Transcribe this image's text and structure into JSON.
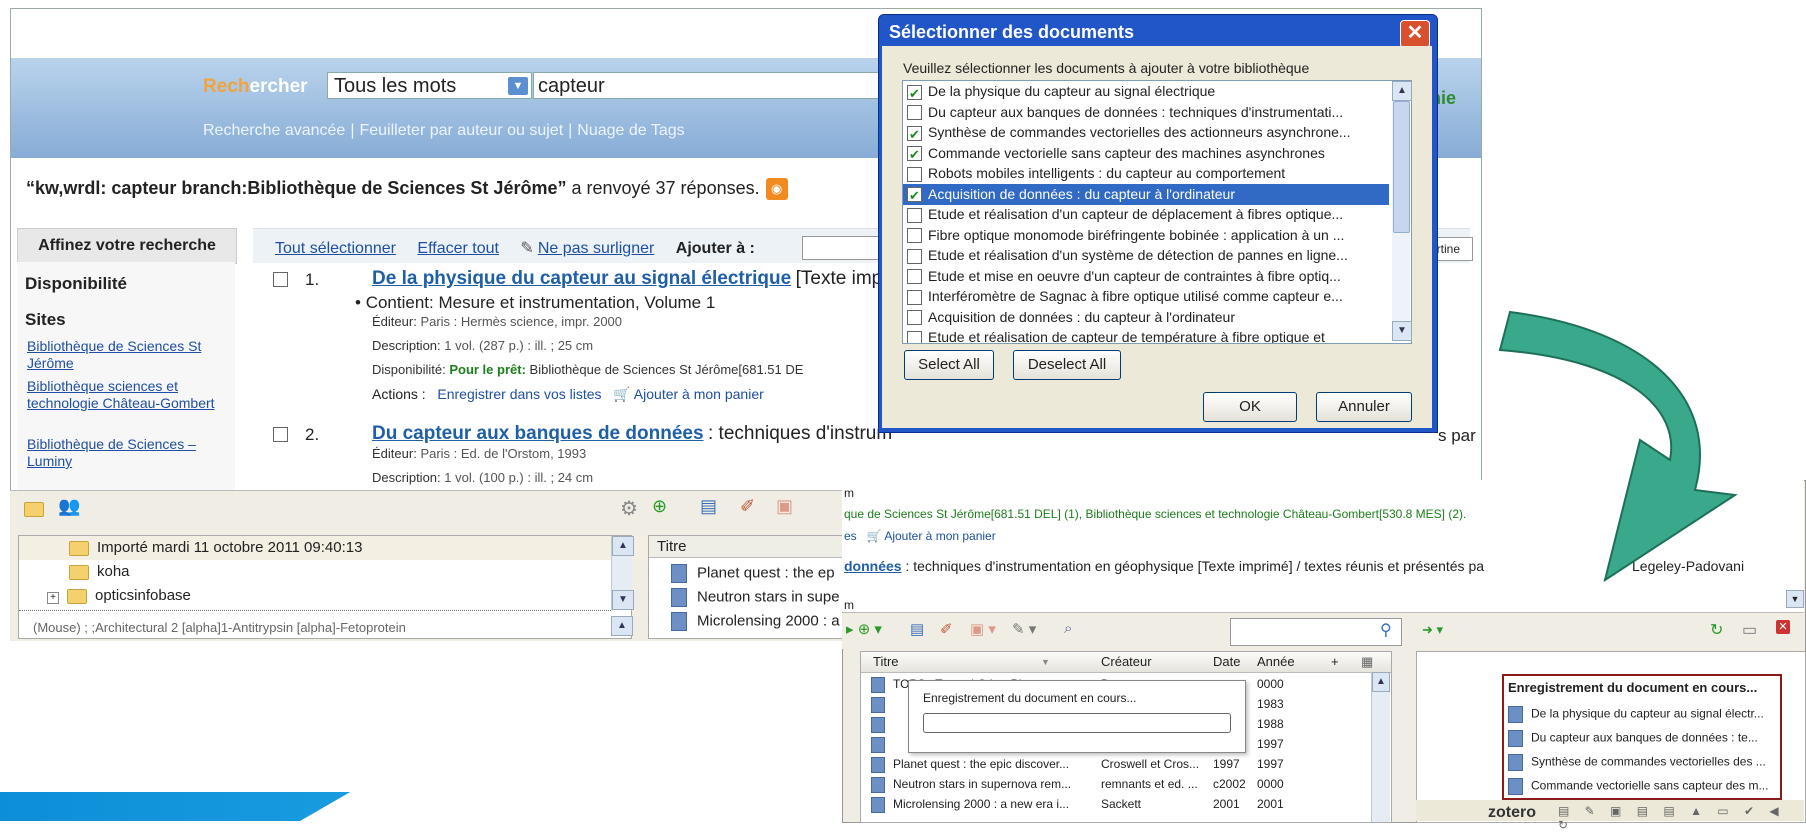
{
  "catalog": {
    "search_label_a": "Rech",
    "search_label_b": "ercher",
    "search_scope": "Tous les mots",
    "search_query": "capteur",
    "links": [
      "Recherche avancée",
      "Feuilleter par auteur ou sujet",
      "Nuage de Tags"
    ],
    "result_query": "“kw,wrdl: capteur branch:Bibliothèque de Sciences St Jérôme”",
    "result_count_text": "a renvoyé 37 réponses.",
    "panier_partial": "anie",
    "refine_header": "Affinez votre recherche",
    "sidebar": {
      "availability": "Disponibilité",
      "sites": "Sites",
      "site_links": [
        "Bibliothèque de Sciences St Jérôme",
        "Bibliothèque sciences et technologie Château-Gombert",
        "Bibliothèque de Sciences – Luminy"
      ]
    },
    "bar": {
      "select_all": "Tout sélectionner",
      "clear_all": "Effacer tout",
      "no_highlight": "Ne pas surligner",
      "add_to": "Ajouter à :",
      "sort_partial": "Pertine"
    },
    "results": [
      {
        "num": "1.",
        "title": "De la physique du capteur au signal électrique",
        "title_suffix": "[Texte imp",
        "contains": "Contient: Mesure et instrumentation, Volume 1",
        "editor_label": "Éditeur:",
        "editor": "Paris : Hermès science, impr. 2000",
        "description_label": "Description:",
        "description": "1 vol. (287 p.) : ill. ; 25 cm",
        "availability_label": "Disponibilité:",
        "availability_loan": "Pour le prêt:",
        "availability_value": "Bibliothèque de Sciences St Jérôme[681.51 DE",
        "actions_label": "Actions :",
        "action_save": "Enregistrer dans vos listes",
        "action_cart": "Ajouter à mon panier"
      },
      {
        "num": "2.",
        "title": "Du capteur aux banques de données",
        "title_suffix": ": techniques d'instrum",
        "suffix_right": "s par",
        "editor_label": "Éditeur:",
        "editor": "Paris : Ed. de l'Orstom, 1993",
        "description_label": "Description:",
        "description": "1 vol. (100 p.) : ill. ; 24 cm"
      }
    ]
  },
  "zotero_left": {
    "tree": [
      "Importé mardi 11 octobre 2011 09:40:13",
      "koha",
      "opticsinfobase"
    ],
    "tree_bottom": "(Mouse)  ;  ;Architectural  2  [alpha]1-Antitrypsin  [alpha]-Fetoprotein",
    "title_header": "Titre",
    "titles": [
      "Planet quest : the ep",
      "Neutron stars in supe",
      "Microlensing 2000 : a"
    ]
  },
  "dialog": {
    "title": "Sélectionner des documents",
    "close": "✕",
    "instruction": "Veuillez sélectionner les documents à ajouter à votre bibliothèque",
    "items": [
      {
        "label": "De la physique du capteur au signal électrique",
        "checked": true
      },
      {
        "label": "Du capteur aux banques de données : techniques d'instrumentati...",
        "checked": false
      },
      {
        "label": "Synthèse de commandes vectorielles des actionneurs asynchrone...",
        "checked": true
      },
      {
        "label": "Commande vectorielle sans capteur des machines asynchrones",
        "checked": true
      },
      {
        "label": "Robots mobiles intelligents : du capteur au comportement",
        "checked": false
      },
      {
        "label": "Acquisition de données : du capteur à l'ordinateur",
        "checked": true,
        "selected": true
      },
      {
        "label": "Etude et réalisation d'un capteur de déplacement à fibres optique...",
        "checked": false
      },
      {
        "label": "Fibre optique monomode biréfringente bobinée : application à un ...",
        "checked": false
      },
      {
        "label": "Etude et réalisation d'un système de détection de pannes en ligne...",
        "checked": false
      },
      {
        "label": "Etude et mise en oeuvre d'un capteur de contraintes à fibre optiq...",
        "checked": false
      },
      {
        "label": "Interféromètre de Sagnac à fibre optique utilisé comme capteur e...",
        "checked": false
      },
      {
        "label": "Acquisition de données : du capteur à l'ordinateur",
        "checked": false
      },
      {
        "label": "Etude et réalisation de capteur de température à fibre optique et",
        "checked": false
      }
    ],
    "select_all": "Select All",
    "deselect_all": "Deselect All",
    "ok": "OK",
    "cancel": "Annuler"
  },
  "zotero_right": {
    "web_line0": "m",
    "web_line1": "que de Sciences St Jérôme[681.51 DEL] (1), Bibliothèque sciences et technologie Château-Gombert[530.8 MES] (2).",
    "web_line2_prefix": "es",
    "web_line2_cart": "Ajouter à mon panier",
    "web_line3_title": "données",
    "web_line3_rest": ": techniques d'instrumentation en géophysique [Texte imprimé] / textes réunis et présentés pa",
    "web_line3_tail": "Legeley-Padovani",
    "web_line4": "m",
    "columns": [
      "Titre",
      "Créateur",
      "Date",
      "Année",
      "+"
    ],
    "rows": [
      {
        "title": "TOPS : Toward Other Planetar...",
        "creator": "D...",
        "date": "",
        "year": "0000"
      },
      {
        "title": "",
        "creator": "",
        "date": "",
        "year": "1983"
      },
      {
        "title": "",
        "creator": "",
        "date": "",
        "year": "1988"
      },
      {
        "title": "",
        "creator": "",
        "date": "",
        "year": "1997"
      },
      {
        "title": "Planet quest : the epic discover...",
        "creator": "Croswell et Cros...",
        "date": "1997",
        "year": "1997"
      },
      {
        "title": "Neutron stars in supernova rem...",
        "creator": "remnants et ed. ...",
        "date": "c2002",
        "year": "0000"
      },
      {
        "title": "Microlensing 2000 : a new era i...",
        "creator": "Sackett",
        "date": "2001",
        "year": "2001"
      }
    ],
    "saving_popup": "Enregistrement du document en cours...",
    "notif_title": "Enregistrement du document en cours...",
    "notif_items": [
      "De la physique du capteur au signal électr...",
      "Du capteur aux banques de données : te...",
      "Synthèse de commandes vectorielles des ...",
      "Commande vectorielle sans capteur des m..."
    ],
    "logo": "zotero"
  },
  "colors": {
    "arrow": "#3aa98b",
    "dialog_title": "#2156c9",
    "accent": "#1e5fa8"
  }
}
